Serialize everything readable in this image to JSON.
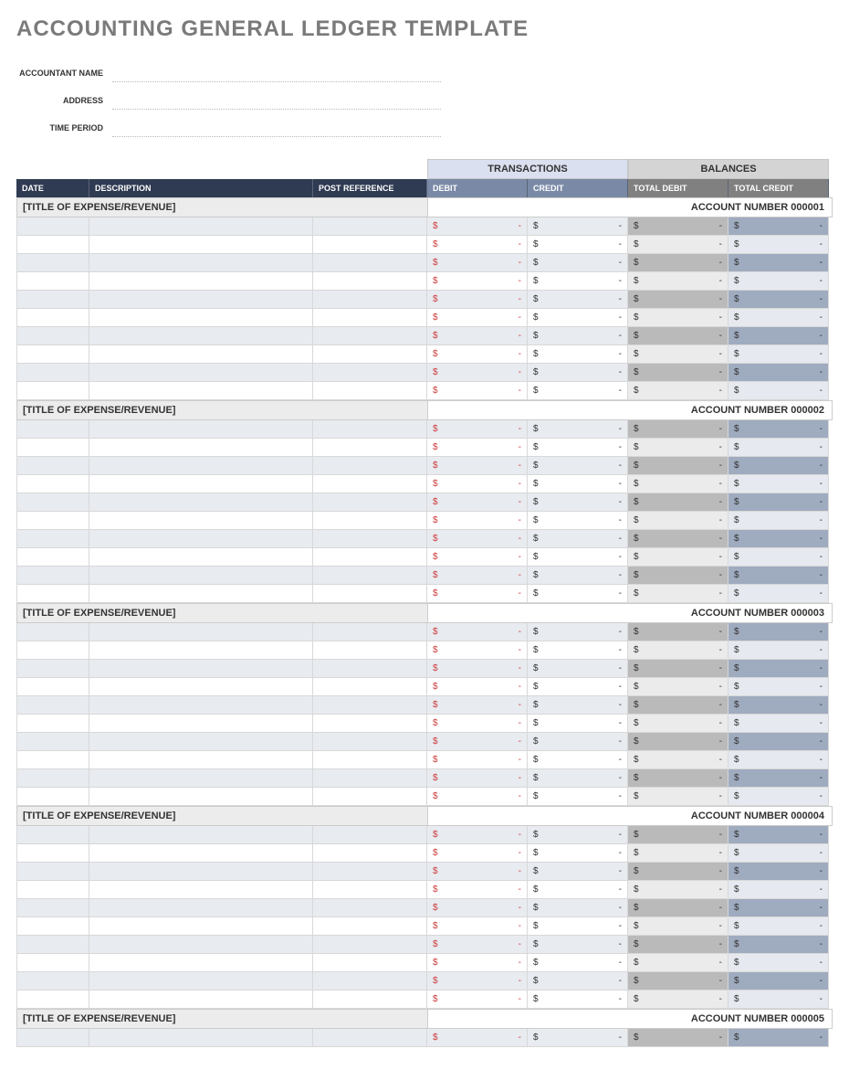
{
  "title": "ACCOUNTING GENERAL LEDGER TEMPLATE",
  "meta": {
    "accountant_name_label": "ACCOUNTANT NAME",
    "address_label": "ADDRESS",
    "time_period_label": "TIME PERIOD",
    "accountant_name": "",
    "address": "",
    "time_period": ""
  },
  "group_headers": {
    "transactions": "TRANSACTIONS",
    "balances": "BALANCES"
  },
  "columns": {
    "date": "DATE",
    "description": "DESCRIPTION",
    "post_reference": "POST REFERENCE",
    "debit": "DEBIT",
    "credit": "CREDIT",
    "total_debit": "TOTAL DEBIT",
    "total_credit": "TOTAL CREDIT"
  },
  "currency_symbol": "$",
  "empty_value": "-",
  "sections": [
    {
      "title": "[TITLE OF EXPENSE/REVENUE]",
      "account_label": "ACCOUNT NUMBER 000001",
      "row_count": 10
    },
    {
      "title": "[TITLE OF EXPENSE/REVENUE]",
      "account_label": "ACCOUNT NUMBER 000002",
      "row_count": 10
    },
    {
      "title": "[TITLE OF EXPENSE/REVENUE]",
      "account_label": "ACCOUNT NUMBER 000003",
      "row_count": 10
    },
    {
      "title": "[TITLE OF EXPENSE/REVENUE]",
      "account_label": "ACCOUNT NUMBER 000004",
      "row_count": 10
    },
    {
      "title": "[TITLE OF EXPENSE/REVENUE]",
      "account_label": "ACCOUNT NUMBER 000005",
      "row_count": 1
    }
  ]
}
